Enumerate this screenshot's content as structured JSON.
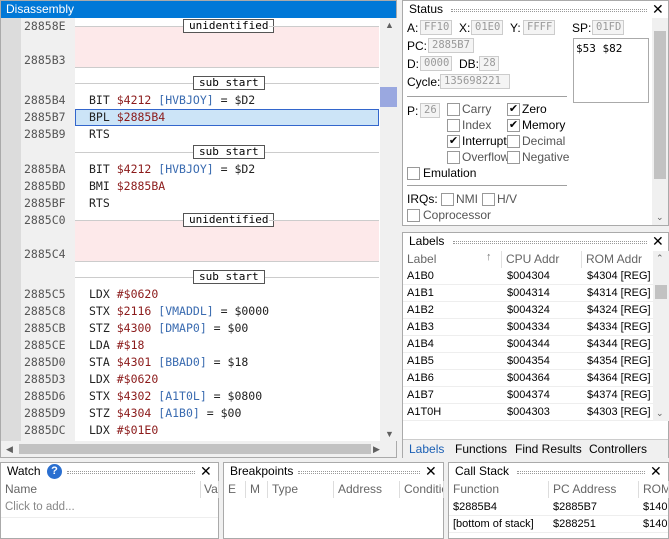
{
  "disassembly": {
    "title": "Disassembly",
    "lines": [
      {
        "addr": "28858E",
        "kind": "marker",
        "marker": "unidentified"
      },
      {
        "addr": "2885B3",
        "kind": "region"
      },
      {
        "addr": "",
        "kind": "marker",
        "marker": "sub start"
      },
      {
        "addr": "2885B4",
        "op": "BIT",
        "arg": "$4212",
        "label": "[HVBJOY]",
        "rest": " = $D2"
      },
      {
        "addr": "2885B7",
        "op": "BPL",
        "arg": "$2885B4",
        "selected": true
      },
      {
        "addr": "2885B9",
        "op": "RTS"
      },
      {
        "addr": "",
        "kind": "marker",
        "marker": "sub start"
      },
      {
        "addr": "2885BA",
        "op": "BIT",
        "arg": "$4212",
        "label": "[HVBJOY]",
        "rest": " = $D2"
      },
      {
        "addr": "2885BD",
        "op": "BMI",
        "arg": "$2885BA"
      },
      {
        "addr": "2885BF",
        "op": "RTS"
      },
      {
        "addr": "2885C0",
        "kind": "marker",
        "marker": "unidentified"
      },
      {
        "addr": "2885C4",
        "kind": "region"
      },
      {
        "addr": "",
        "kind": "marker",
        "marker": "sub start"
      },
      {
        "addr": "2885C5",
        "op": "LDX",
        "arg": "#$0620"
      },
      {
        "addr": "2885C8",
        "op": "STX",
        "arg": "$2116",
        "label": "[VMADDL]",
        "rest": " = $0000"
      },
      {
        "addr": "2885CB",
        "op": "STZ",
        "arg": "$4300",
        "label": "[DMAP0]",
        "rest": " = $00"
      },
      {
        "addr": "2885CE",
        "op": "LDA",
        "arg": "#$18"
      },
      {
        "addr": "2885D0",
        "op": "STA",
        "arg": "$4301",
        "label": "[BBAD0]",
        "rest": " = $18"
      },
      {
        "addr": "2885D3",
        "op": "LDX",
        "arg": "#$0620"
      },
      {
        "addr": "2885D6",
        "op": "STX",
        "arg": "$4302",
        "label": "[A1T0L]",
        "rest": " = $0800"
      },
      {
        "addr": "2885D9",
        "op": "STZ",
        "arg": "$4304",
        "label": "[A1B0]",
        "rest": " = $00"
      },
      {
        "addr": "2885DC",
        "op": "LDX",
        "arg": "#$01E0"
      }
    ]
  },
  "status": {
    "title": "Status",
    "registers": {
      "a_label": "A:",
      "a": "FF10",
      "x_label": "X:",
      "x": "01E0",
      "y_label": "Y:",
      "y": "FFFF",
      "sp_label": "SP:",
      "sp": "01FD",
      "pc_label": "PC:",
      "pc": "2885B7",
      "d_label": "D:",
      "d": "0000",
      "db_label": "DB:",
      "db": "28",
      "cycle_label": "Cycle:",
      "cycle": "135698221",
      "p_label": "P:",
      "p": "26"
    },
    "stack": "$53 $82",
    "flags": [
      {
        "name": "Carry",
        "checked": false
      },
      {
        "name": "Zero",
        "checked": true
      },
      {
        "name": "Index",
        "checked": false
      },
      {
        "name": "Memory",
        "checked": true
      },
      {
        "name": "Interrupt",
        "checked": true
      },
      {
        "name": "Decimal",
        "checked": false
      },
      {
        "name": "Overflow",
        "checked": false
      },
      {
        "name": "Negative",
        "checked": false
      }
    ],
    "emulation": "Emulation",
    "irqs_label": "IRQs:",
    "nmi": "NMI",
    "hv": "H/V",
    "coprocessor": "Coprocessor"
  },
  "labels": {
    "title": "Labels",
    "columns": [
      "Label",
      "CPU Addr",
      "ROM Addr"
    ],
    "rows": [
      {
        "label": "A1B0",
        "cpu": "$004304",
        "rom": "$4304 [REG]"
      },
      {
        "label": "A1B1",
        "cpu": "$004314",
        "rom": "$4314 [REG]"
      },
      {
        "label": "A1B2",
        "cpu": "$004324",
        "rom": "$4324 [REG]"
      },
      {
        "label": "A1B3",
        "cpu": "$004334",
        "rom": "$4334 [REG]"
      },
      {
        "label": "A1B4",
        "cpu": "$004344",
        "rom": "$4344 [REG]"
      },
      {
        "label": "A1B5",
        "cpu": "$004354",
        "rom": "$4354 [REG]"
      },
      {
        "label": "A1B6",
        "cpu": "$004364",
        "rom": "$4364 [REG]"
      },
      {
        "label": "A1B7",
        "cpu": "$004374",
        "rom": "$4374 [REG]"
      },
      {
        "label": "A1T0H",
        "cpu": "$004303",
        "rom": "$4303 [REG]"
      }
    ],
    "tabs": [
      "Labels",
      "Functions",
      "Find Results",
      "Controllers"
    ]
  },
  "watch": {
    "title": "Watch",
    "columns": [
      "Name",
      "Va"
    ],
    "placeholder": "Click to add..."
  },
  "breakpoints": {
    "title": "Breakpoints",
    "columns": [
      "E",
      "M",
      "Type",
      "Address",
      "Conditic"
    ]
  },
  "callstack": {
    "title": "Call Stack",
    "columns": [
      "Function",
      "PC Address",
      "ROM"
    ],
    "rows": [
      {
        "fn": "$2885B4",
        "pc": "$2885B7",
        "rom": "$140"
      },
      {
        "fn": "[bottom of stack]",
        "pc": "$288251",
        "rom": "$140"
      }
    ]
  }
}
